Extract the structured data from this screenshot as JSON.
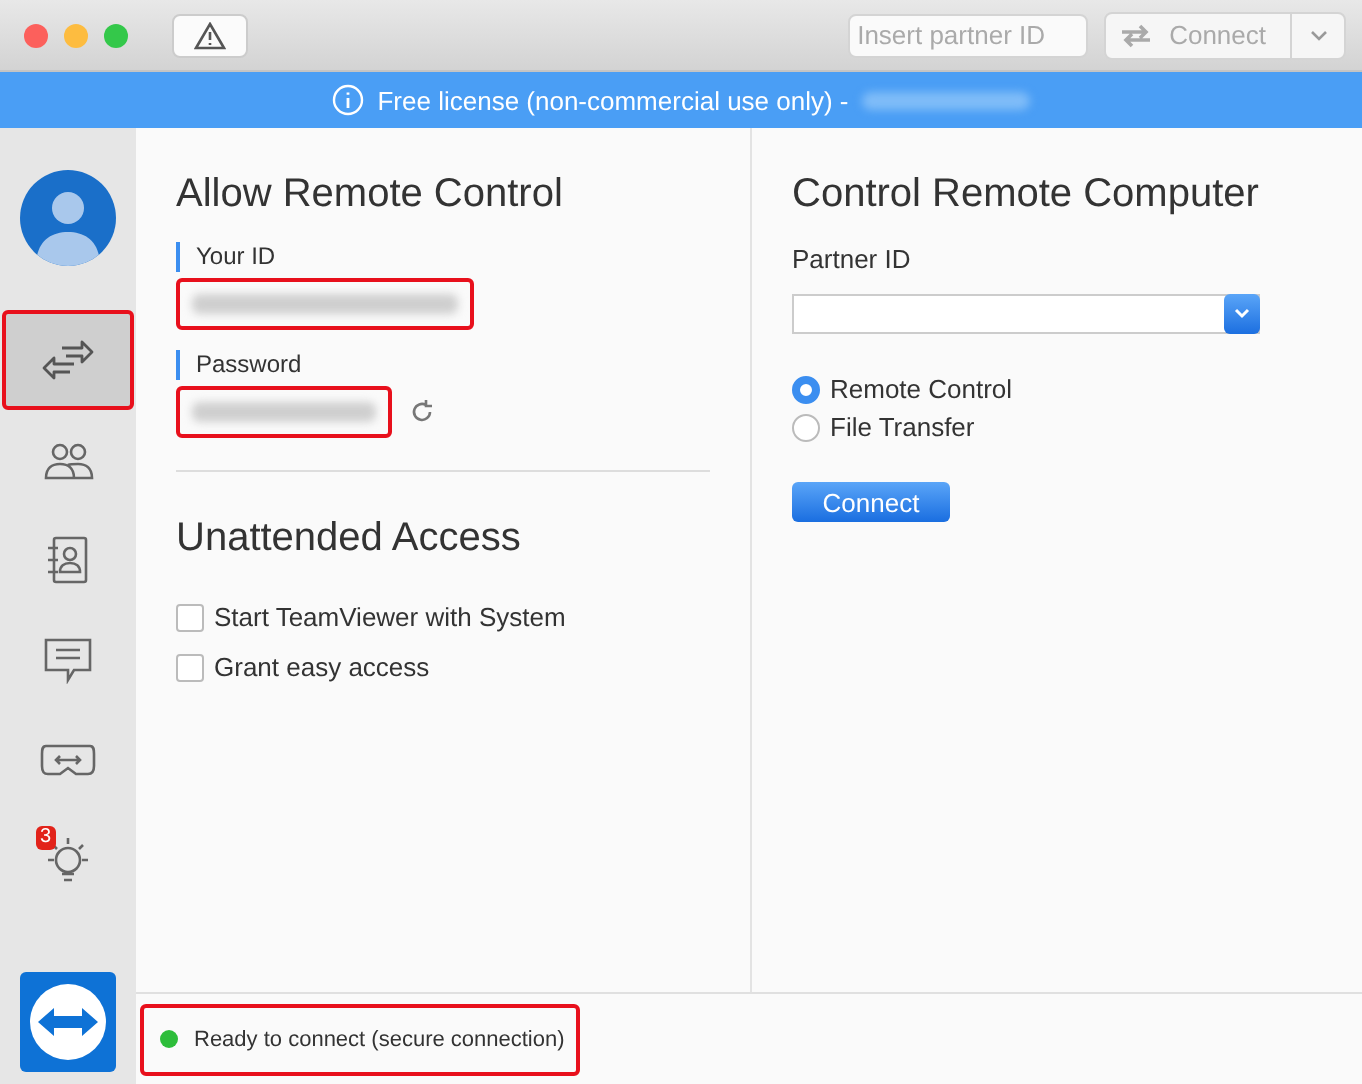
{
  "toolbar": {
    "partner_id": {
      "placeholder": "Insert partner ID"
    },
    "connect_button": "Connect"
  },
  "banner": {
    "text": "Free license (non-commercial use only) -"
  },
  "sidebar": {
    "items": [
      {
        "kind": "connect",
        "selected": true,
        "highlighted": true
      },
      {
        "kind": "contacts",
        "selected": false,
        "highlighted": false
      },
      {
        "kind": "directory",
        "selected": false,
        "highlighted": false
      },
      {
        "kind": "chat",
        "selected": false,
        "highlighted": false
      },
      {
        "kind": "meeting",
        "selected": false,
        "highlighted": false
      },
      {
        "kind": "tips",
        "selected": false,
        "highlighted": false,
        "badge": "3"
      }
    ]
  },
  "allow_remote_control": {
    "title": "Allow Remote Control",
    "fields": [
      {
        "label": "Your ID",
        "highlighted": true,
        "refresh": false
      },
      {
        "label": "Password",
        "highlighted": true,
        "refresh": true
      }
    ]
  },
  "unattended_access": {
    "title": "Unattended Access",
    "options": [
      {
        "label": "Start TeamViewer with System",
        "checked": false
      },
      {
        "label": "Grant easy access",
        "checked": false
      }
    ]
  },
  "control_remote_computer": {
    "title": "Control Remote Computer",
    "partner_id_label": "Partner ID",
    "modes": [
      {
        "label": "Remote Control",
        "selected": true
      },
      {
        "label": "File Transfer",
        "selected": false
      }
    ],
    "connect_button": "Connect"
  },
  "status_bar": {
    "text": "Ready to connect (secure connection)",
    "color": "#2dbd3a",
    "highlighted": true
  }
}
